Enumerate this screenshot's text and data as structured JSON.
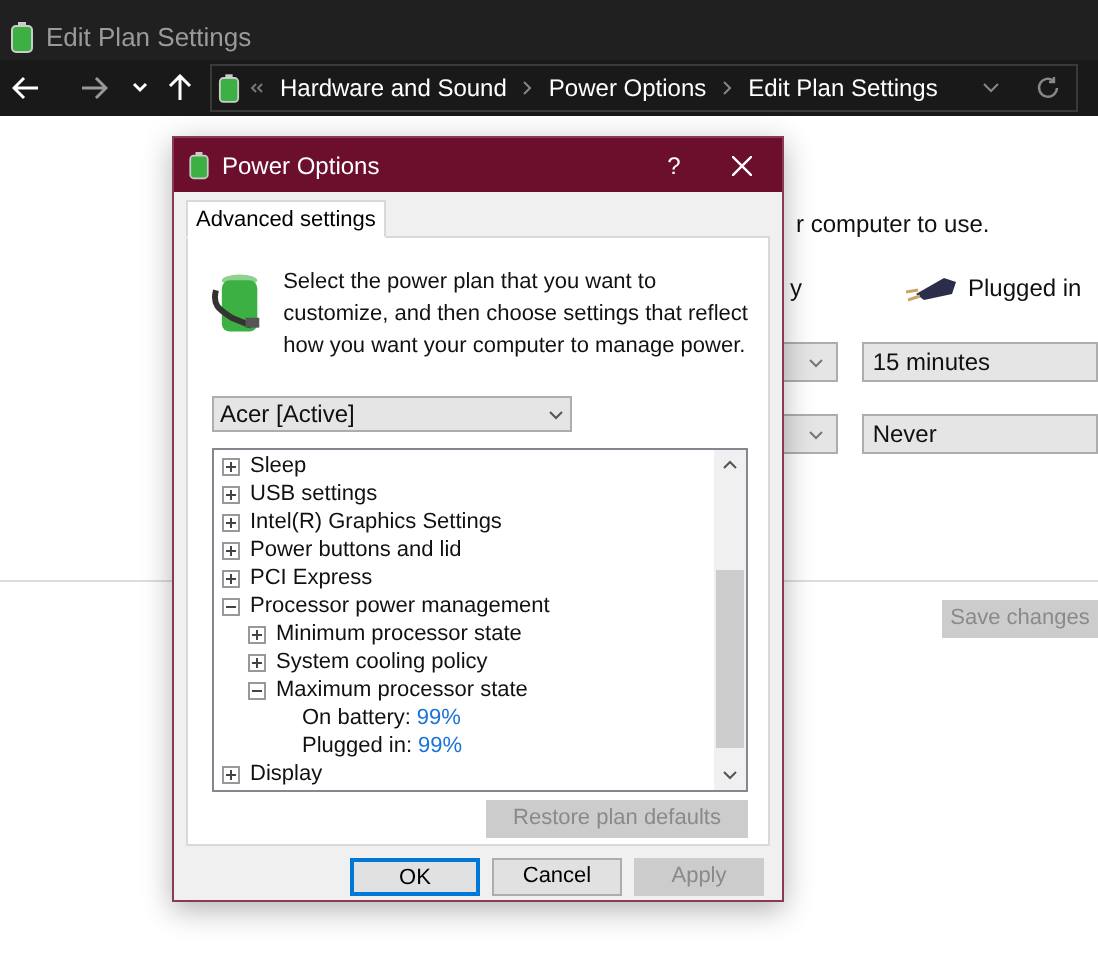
{
  "window": {
    "title": "Edit Plan Settings"
  },
  "navigation": {
    "breadcrumb": [
      "Hardware and Sound",
      "Power Options",
      "Edit Plan Settings"
    ]
  },
  "page": {
    "intro_fragment": "r computer to use.",
    "battery_header_fragment": "y",
    "plugged_in_header": "Plugged in",
    "settings": [
      {
        "plugged_in_value": "15 minutes"
      },
      {
        "plugged_in_value": "Never"
      }
    ],
    "save_button": {
      "label": "Save changes",
      "disabled": true
    }
  },
  "dialog": {
    "title": "Power Options",
    "help": "?",
    "tabs": [
      {
        "label": "Advanced settings",
        "selected": true
      }
    ],
    "description": "Select the power plan that you want to customize, and then choose settings that reflect how you want your computer to manage power.",
    "plan": "Acer [Active]",
    "tree": [
      {
        "kind": "group",
        "label": "Sleep",
        "expanded": false
      },
      {
        "kind": "group",
        "label": "USB settings",
        "expanded": false
      },
      {
        "kind": "group",
        "label": "Intel(R) Graphics Settings",
        "expanded": false
      },
      {
        "kind": "group",
        "label": "Power buttons and lid",
        "expanded": false
      },
      {
        "kind": "group",
        "label": "PCI Express",
        "expanded": false
      },
      {
        "kind": "group",
        "label": "Processor power management",
        "expanded": true,
        "children": [
          {
            "kind": "group",
            "label": "Minimum processor state",
            "expanded": false
          },
          {
            "kind": "group",
            "label": "System cooling policy",
            "expanded": false
          },
          {
            "kind": "group",
            "label": "Maximum processor state",
            "expanded": true,
            "children": [
              {
                "kind": "value",
                "label": "On battery:",
                "value": "99%"
              },
              {
                "kind": "value",
                "label": "Plugged in:",
                "value": "99%"
              }
            ]
          }
        ]
      },
      {
        "kind": "group",
        "label": "Display",
        "expanded": false
      }
    ],
    "restore_button": {
      "label": "Restore plan defaults",
      "disabled": true
    },
    "buttons": [
      {
        "label": "OK",
        "focused": true,
        "disabled": false
      },
      {
        "label": "Cancel",
        "focused": false,
        "disabled": false
      },
      {
        "label": "Apply",
        "focused": false,
        "disabled": true
      }
    ]
  }
}
